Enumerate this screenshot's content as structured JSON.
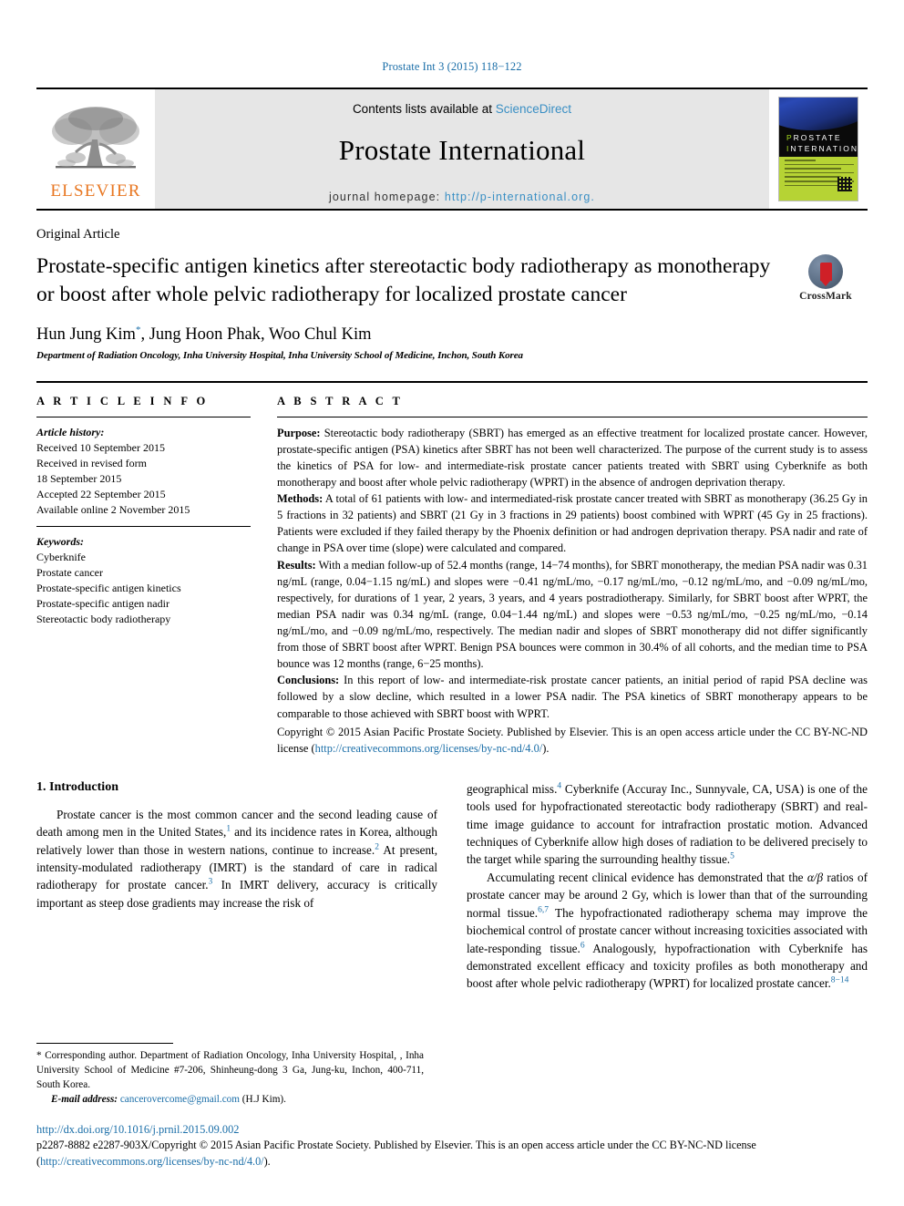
{
  "running_head": "Prostate Int 3 (2015) 118−122",
  "masthead": {
    "publisher_name": "ELSEVIER",
    "contents_prefix": "Contents lists available at ",
    "contents_link": "ScienceDirect",
    "journal_name": "Prostate International",
    "homepage_label": "journal homepage: ",
    "homepage_url": "http://p-international.org.",
    "cover": {
      "title_line1": "PROSTATE",
      "title_line2": "INTERNATIONAL"
    }
  },
  "article": {
    "type": "Original Article",
    "title": "Prostate-specific antigen kinetics after stereotactic body radiotherapy as monotherapy or boost after whole pelvic radiotherapy for localized prostate cancer",
    "crossmark_label": "CrossMark",
    "authors": "Hun Jung Kim, Jung Hoon Phak, Woo Chul Kim",
    "author_marker": "*",
    "affiliation": "Department of Radiation Oncology, Inha University Hospital, Inha University School of Medicine, Inchon, South Korea"
  },
  "info": {
    "heading": "A R T I C L E   I N F O",
    "history_label": "Article history:",
    "history": [
      "Received 10 September 2015",
      "Received in revised form",
      "18 September 2015",
      "Accepted 22 September 2015",
      "Available online 2 November 2015"
    ],
    "keywords_label": "Keywords:",
    "keywords": [
      "Cyberknife",
      "Prostate cancer",
      "Prostate-specific antigen kinetics",
      "Prostate-specific antigen nadir",
      "Stereotactic body radiotherapy"
    ]
  },
  "abstract": {
    "heading": "A B S T R A C T",
    "purpose_label": "Purpose:",
    "purpose_text": " Stereotactic body radiotherapy (SBRT) has emerged as an effective treatment for localized prostate cancer. However, prostate-specific antigen (PSA) kinetics after SBRT has not been well characterized. The purpose of the current study is to assess the kinetics of PSA for low- and intermediate-risk prostate cancer patients treated with SBRT using Cyberknife as both monotherapy and boost after whole pelvic radiotherapy (WPRT) in the absence of androgen deprivation therapy.",
    "methods_label": "Methods:",
    "methods_text": " A total of 61 patients with low- and intermediated-risk prostate cancer treated with SBRT as monotherapy (36.25 Gy in 5 fractions in 32 patients) and SBRT (21 Gy in 3 fractions in 29 patients) boost combined with WPRT (45 Gy in 25 fractions). Patients were excluded if they failed therapy by the Phoenix definition or had androgen deprivation therapy. PSA nadir and rate of change in PSA over time (slope) were calculated and compared.",
    "results_label": "Results:",
    "results_text": " With a median follow-up of 52.4 months (range, 14−74 months), for SBRT monotherapy, the median PSA nadir was 0.31 ng/mL (range, 0.04−1.15 ng/mL) and slopes were −0.41 ng/mL/mo, −0.17 ng/mL/mo, −0.12 ng/mL/mo, and −0.09 ng/mL/mo, respectively, for durations of 1 year, 2 years, 3 years, and 4 years postradiotherapy. Similarly, for SBRT boost after WPRT, the median PSA nadir was 0.34 ng/mL (range, 0.04−1.44 ng/mL) and slopes were −0.53 ng/mL/mo, −0.25 ng/mL/mo, −0.14 ng/mL/mo, and −0.09 ng/mL/mo, respectively. The median nadir and slopes of SBRT monotherapy did not differ significantly from those of SBRT boost after WPRT. Benign PSA bounces were common in 30.4% of all cohorts, and the median time to PSA bounce was 12 months (range, 6−25 months).",
    "conclusions_label": "Conclusions:",
    "conclusions_text": " In this report of low- and intermediate-risk prostate cancer patients, an initial period of rapid PSA decline was followed by a slow decline, which resulted in a lower PSA nadir. The PSA kinetics of SBRT monotherapy appears to be comparable to those achieved with SBRT boost with WPRT.",
    "copyright_text": "Copyright © 2015 Asian Pacific Prostate Society. Published by Elsevier. This is an open access article under the CC BY-NC-ND license (",
    "copyright_link": "http://creativecommons.org/licenses/by-nc-nd/4.0/",
    "copyright_tail": ")."
  },
  "body": {
    "section_number_title": "1. Introduction",
    "left_paragraph_1": "Prostate cancer is the most common cancer and the second leading cause of death among men in the United States,",
    "left_sup_1": "1",
    "left_paragraph_1b": " and its incidence rates in Korea, although relatively lower than those in western nations, continue to increase.",
    "left_sup_2": "2",
    "left_paragraph_1c": " At present, intensity-modulated radiotherapy (IMRT) is the standard of care in radical radiotherapy for prostate cancer.",
    "left_sup_3": "3",
    "left_paragraph_1d": " In IMRT delivery, accuracy is critically important as steep dose gradients may increase the risk of",
    "right_paragraph_1": "geographical miss.",
    "right_sup_4": "4",
    "right_paragraph_1b": " Cyberknife (Accuray Inc., Sunnyvale, CA, USA) is one of the tools used for hypofractionated stereotactic body radiotherapy (SBRT) and real-time image guidance to account for intrafraction prostatic motion. Advanced techniques of Cyberknife allow high doses of radiation to be delivered precisely to the target while sparing the surrounding healthy tissue.",
    "right_sup_5": "5",
    "right_paragraph_2a": "Accumulating recent clinical evidence has demonstrated that the ",
    "right_alpha_beta": "α/β",
    "right_paragraph_2b": " ratios of prostate cancer may be around 2 Gy, which is lower than that of the surrounding normal tissue.",
    "right_sup_67": "6,7",
    "right_paragraph_2c": " The hypofractionated radiotherapy schema may improve the biochemical control of prostate cancer without increasing toxicities associated with late-responding tissue.",
    "right_sup_6": "6",
    "right_paragraph_2d": " Analogously, hypofractionation with Cyberknife has demonstrated excellent efficacy and toxicity profiles as both monotherapy and boost after whole pelvic radiotherapy (WPRT) for localized prostate cancer.",
    "right_sup_814": "8−14"
  },
  "footer": {
    "corresponding_marker": "*",
    "corresponding_text": " Corresponding author. Department of Radiation Oncology, Inha University Hospital, , Inha University School of Medicine #7-206, Shinheung-dong 3 Ga, Jung-ku, Inchon, 400-711, South Korea.",
    "email_label": "E-mail address:",
    "email_value": "cancerovercome@gmail.com",
    "email_suffix": " (H.J Kim).",
    "doi": "http://dx.doi.org/10.1016/j.prnil.2015.09.002",
    "issn_text": "p2287-8882 e2287-903X/Copyright © 2015 Asian Pacific Prostate Society. Published by Elsevier. This is an open access article under the CC BY-NC-ND license (",
    "issn_link": "http://creativecommons.org/licenses/by-nc-nd/4.0/",
    "issn_tail": ")."
  },
  "colors": {
    "link": "#1a6ea8",
    "elsevier_orange": "#e87722",
    "band_gray": "#e6e6e6"
  }
}
